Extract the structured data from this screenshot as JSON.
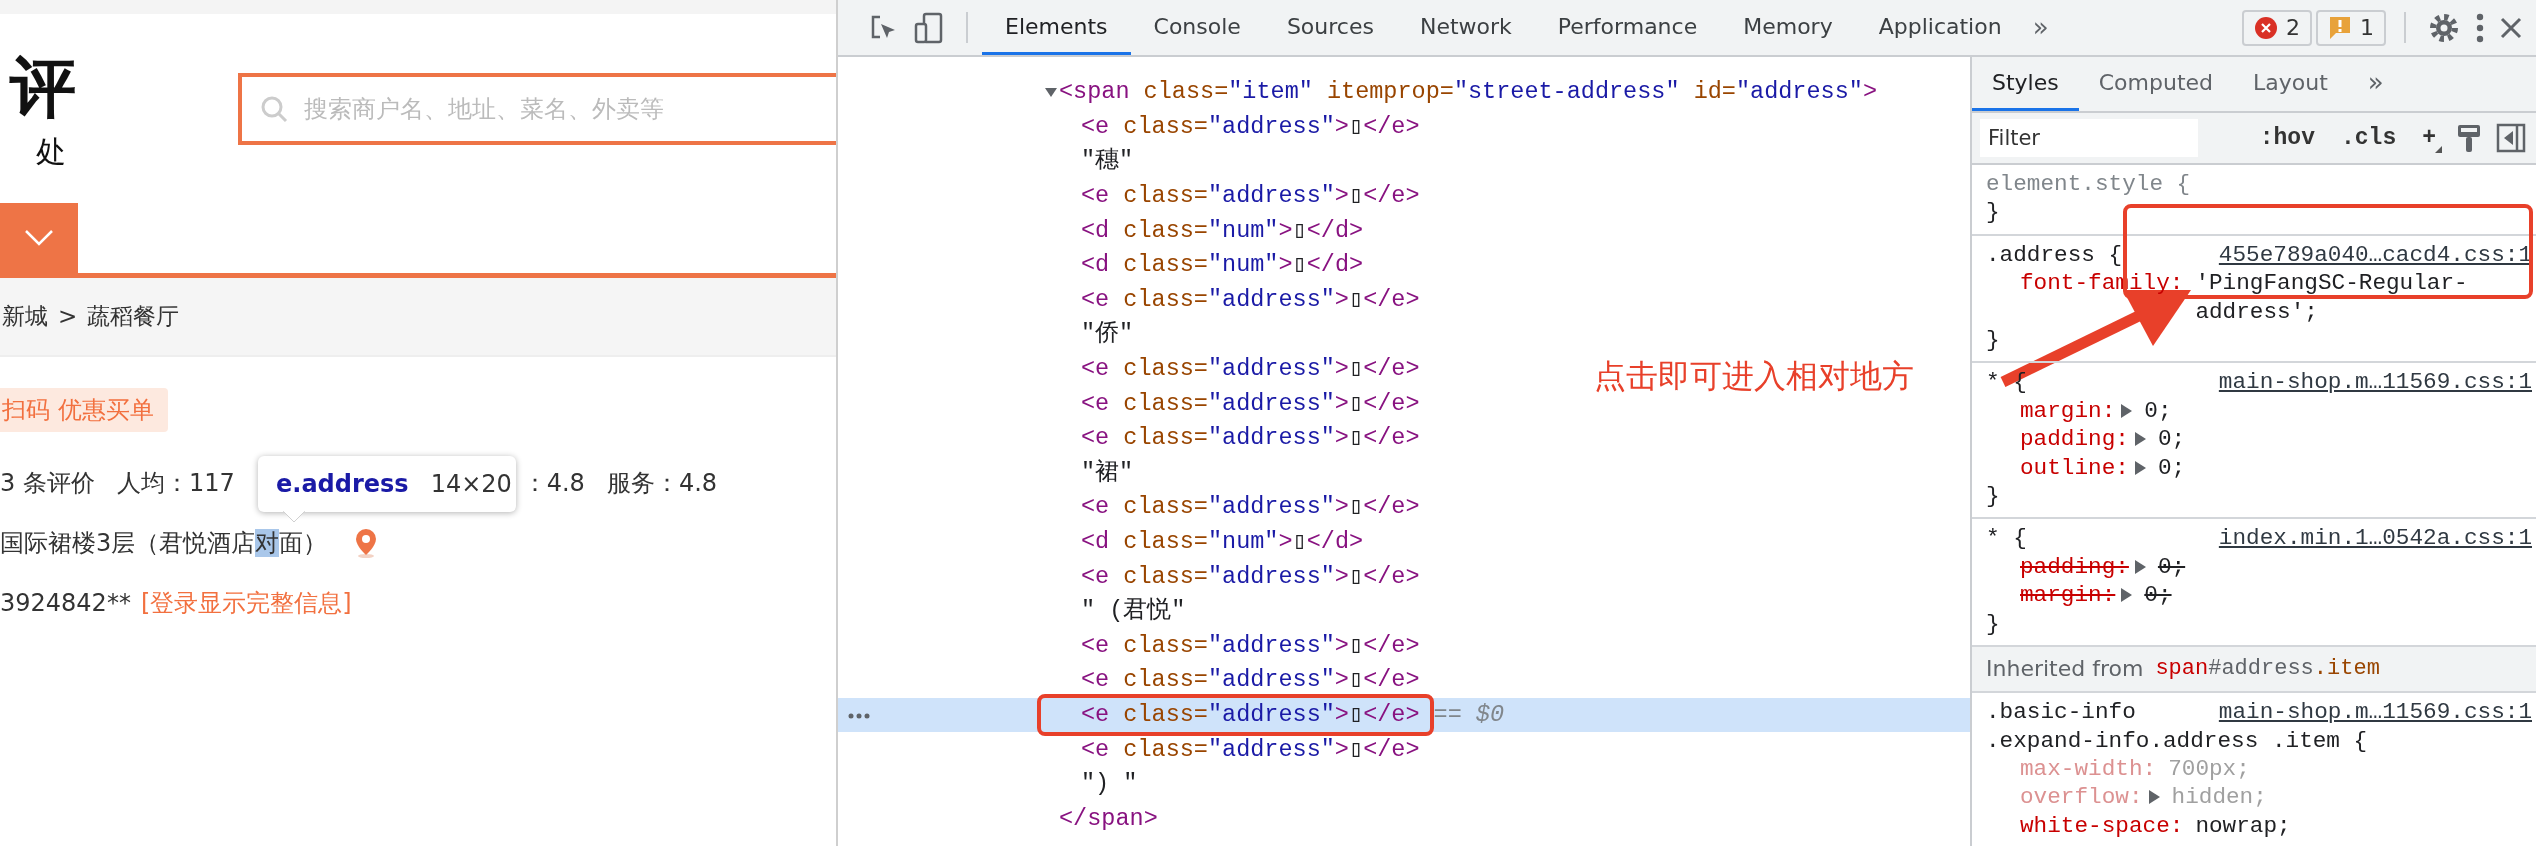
{
  "page": {
    "logo_title": "评",
    "logo_slogan": "处",
    "search": {
      "placeholder": "搜索商户名、地址、菜名、外卖等"
    },
    "breadcrumb": {
      "items": [
        "新城",
        "蔬稻餐厅"
      ],
      "separator": ">"
    },
    "promo_badge": "扫码 优惠买单",
    "stats": [
      "3 条评价",
      "人均：117",
      "：4.8",
      "服务：4.8"
    ],
    "address": {
      "before": "国际裙楼3层（君悦酒店",
      "highlighted": "对",
      "after": "面）"
    },
    "phone": "3924842**",
    "login_link": "[登录显示完整信息]",
    "tooltip": {
      "selector": "e.address",
      "size": "14×20"
    }
  },
  "devtools": {
    "tabs": [
      {
        "label": "Elements",
        "selected": true
      },
      {
        "label": "Console",
        "selected": false
      },
      {
        "label": "Sources",
        "selected": false
      },
      {
        "label": "Network",
        "selected": false
      },
      {
        "label": "Performance",
        "selected": false
      },
      {
        "label": "Memory",
        "selected": false
      },
      {
        "label": "Application",
        "selected": false
      }
    ],
    "more_tabs": "»",
    "issues": {
      "errors": "2",
      "warnings": "1"
    },
    "elements": {
      "selected_suffix": "== $0",
      "tree": [
        {
          "kind": "element",
          "markup": "<span class=\"item\" itemprop=\"street-address\" id=\"address\">",
          "expanded": true,
          "selected": false,
          "closing": "</span>",
          "children": [
            {
              "kind": "element",
              "markup": "<e class=\"address\">▯</e>",
              "selected": false
            },
            {
              "kind": "text",
              "markup": "\"穗\"",
              "selected": false
            },
            {
              "kind": "element",
              "markup": "<e class=\"address\">▯</e>",
              "selected": false
            },
            {
              "kind": "element",
              "markup": "<d class=\"num\">▯</d>",
              "selected": false
            },
            {
              "kind": "element",
              "markup": "<d class=\"num\">▯</d>",
              "selected": false
            },
            {
              "kind": "element",
              "markup": "<e class=\"address\">▯</e>",
              "selected": false
            },
            {
              "kind": "text",
              "markup": "\"侨\"",
              "selected": false
            },
            {
              "kind": "element",
              "markup": "<e class=\"address\">▯</e>",
              "selected": false
            },
            {
              "kind": "element",
              "markup": "<e class=\"address\">▯</e>",
              "selected": false
            },
            {
              "kind": "element",
              "markup": "<e class=\"address\">▯</e>",
              "selected": false
            },
            {
              "kind": "text",
              "markup": "\"裙\"",
              "selected": false
            },
            {
              "kind": "element",
              "markup": "<e class=\"address\">▯</e>",
              "selected": false
            },
            {
              "kind": "element",
              "markup": "<d class=\"num\">▯</d>",
              "selected": false
            },
            {
              "kind": "element",
              "markup": "<e class=\"address\">▯</e>",
              "selected": false
            },
            {
              "kind": "text",
              "markup": "\" (君悦\"",
              "selected": false
            },
            {
              "kind": "element",
              "markup": "<e class=\"address\">▯</e>",
              "selected": false
            },
            {
              "kind": "element",
              "markup": "<e class=\"address\">▯</e>",
              "selected": false
            },
            {
              "kind": "element",
              "markup": "<e class=\"address\">▯</e>",
              "selected": true
            },
            {
              "kind": "element",
              "markup": "<e class=\"address\">▯</e>",
              "selected": false
            },
            {
              "kind": "text",
              "markup": "\") \"",
              "selected": false
            }
          ]
        }
      ]
    },
    "styles": {
      "tabs": [
        {
          "label": "Styles",
          "selected": true
        },
        {
          "label": "Computed",
          "selected": false
        },
        {
          "label": "Layout",
          "selected": false
        }
      ],
      "more_tabs": "»",
      "filter": {
        "placeholder": "Filter"
      },
      "hov": ":hov",
      "cls": ".cls",
      "add": "+",
      "rules": [
        {
          "kind": "inline",
          "selector": [
            "element.style {"
          ],
          "close": "}"
        },
        {
          "kind": "rule",
          "selector": [
            ".address {"
          ],
          "source": "455e789a040…cacd4.css:1",
          "close": "}",
          "properties": [
            {
              "name": "font-family:",
              "value": "'PingFangSC-Regular-address';",
              "expandable": false,
              "struck": false,
              "inactive": false
            }
          ]
        },
        {
          "kind": "rule",
          "selector": [
            "* {"
          ],
          "source": "main-shop.m…11569.css:1",
          "close": "}",
          "properties": [
            {
              "name": "margin:",
              "value": "0;",
              "expandable": true,
              "struck": false,
              "inactive": false
            },
            {
              "name": "padding:",
              "value": "0;",
              "expandable": true,
              "struck": false,
              "inactive": false
            },
            {
              "name": "outline:",
              "value": "0;",
              "expandable": true,
              "struck": false,
              "inactive": false
            }
          ]
        },
        {
          "kind": "rule",
          "selector": [
            "* {"
          ],
          "source": "index.min.1…0542a.css:1",
          "close": "}",
          "properties": [
            {
              "name": "padding:",
              "value": "0;",
              "expandable": true,
              "struck": true,
              "inactive": false
            },
            {
              "name": "margin:",
              "value": "0;",
              "expandable": true,
              "struck": true,
              "inactive": false
            }
          ]
        },
        {
          "kind": "inherited",
          "label": "Inherited from",
          "parts": [
            {
              "kind": "tag",
              "text": "span"
            },
            {
              "kind": "id",
              "text": "#address"
            },
            {
              "kind": "class",
              "text": ".item"
            }
          ]
        },
        {
          "kind": "rule",
          "selector": [
            ".basic-info",
            ".expand-info.address .item {"
          ],
          "source": "main-shop.m…11569.css:1",
          "properties": [
            {
              "name": "max-width:",
              "value": "700px;",
              "expandable": false,
              "struck": false,
              "inactive": true
            },
            {
              "name": "overflow:",
              "value": "hidden;",
              "expandable": true,
              "struck": false,
              "inactive": true
            },
            {
              "name": "white-space:",
              "value": "nowrap;",
              "expandable": false,
              "struck": false,
              "inactive": false
            }
          ]
        }
      ]
    }
  },
  "annotations": [
    {
      "kind": "frame"
    },
    {
      "kind": "node_frame"
    },
    {
      "kind": "arrow"
    },
    {
      "kind": "note",
      "text": "点击即可进入相对地方"
    }
  ]
}
